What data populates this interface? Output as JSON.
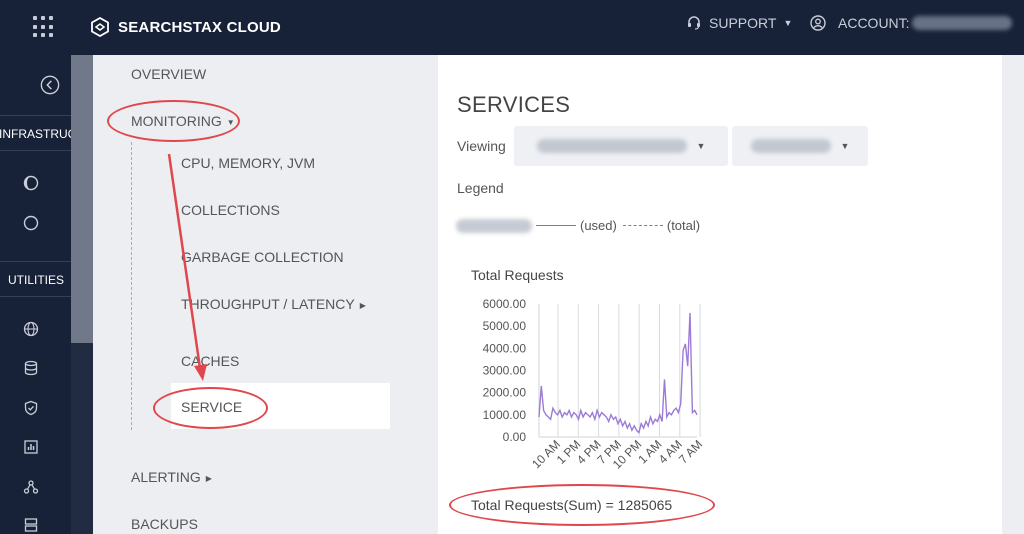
{
  "topbar": {
    "brand": "SEARCHSTAX CLOUD",
    "support_label": "SUPPORT",
    "account_label": "ACCOUNT:"
  },
  "rail": {
    "section_infrastructure": "INFRASTRUCTURE",
    "section_utilities": "UTILITIES"
  },
  "nav": {
    "overview": "OVERVIEW",
    "monitoring": "MONITORING",
    "items": [
      "CPU, MEMORY, JVM",
      "COLLECTIONS",
      "GARBAGE COLLECTION",
      "THROUGHPUT / LATENCY",
      "CACHES",
      "SERVICE"
    ],
    "alerting": "ALERTING",
    "backups": "BACKUPS"
  },
  "main": {
    "title": "SERVICES",
    "viewing_label": "Viewing",
    "legend_title": "Legend",
    "legend_used": "(used)",
    "legend_total": "(total)",
    "sum_text": "Total Requests(Sum) = 1285065"
  },
  "chart_data": {
    "type": "line",
    "title": "Total Requests",
    "ylim": [
      0,
      6000
    ],
    "yticks": [
      "6000.00",
      "5000.00",
      "4000.00",
      "3000.00",
      "2000.00",
      "1000.00",
      "0.00"
    ],
    "xticks": [
      "10 AM",
      "1 PM",
      "4 PM",
      "7 PM",
      "10 PM",
      "1 AM",
      "4 AM",
      "7 AM"
    ],
    "grid": "vertical",
    "color": "#9b7bd6",
    "values": [
      900,
      2300,
      1200,
      1000,
      900,
      800,
      1300,
      1100,
      1000,
      1200,
      900,
      1100,
      1000,
      1200,
      900,
      1100,
      1000,
      800,
      1200,
      900,
      1100,
      1000,
      900,
      1100,
      800,
      1200,
      900,
      1100,
      1000,
      900,
      700,
      1000,
      800,
      900,
      600,
      800,
      500,
      700,
      400,
      600,
      300,
      500,
      300,
      200,
      600,
      400,
      700,
      500,
      900,
      600,
      800,
      700,
      1000,
      700,
      2600,
      900,
      1100,
      1000,
      1200,
      1300,
      1100,
      1500,
      3900,
      4200,
      3200,
      5600,
      1100,
      1200,
      1000
    ]
  }
}
